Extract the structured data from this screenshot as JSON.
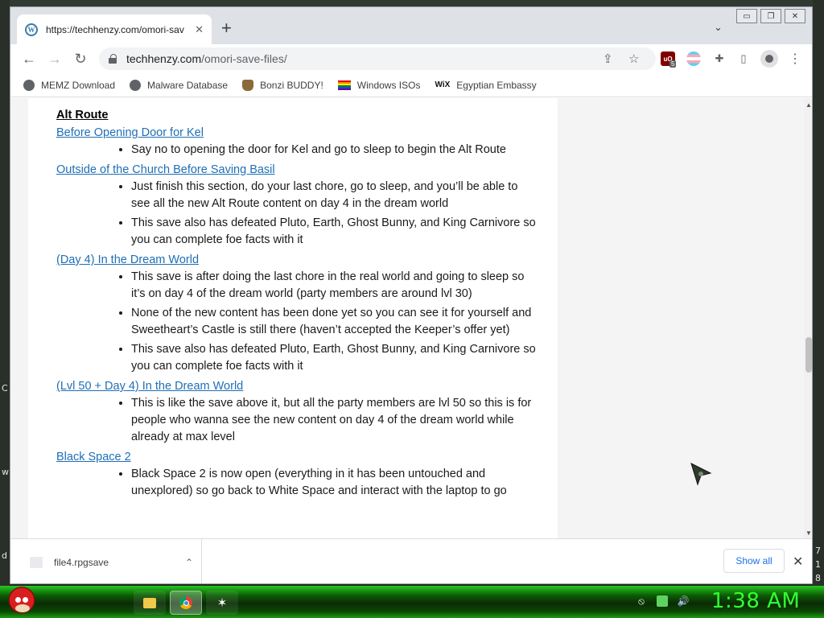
{
  "desktop": {
    "edge_left_chars": [
      "C",
      "w",
      "d"
    ],
    "edge_right_chars": [
      "7",
      "1",
      "8"
    ]
  },
  "window_controls": {
    "minimize": "▭",
    "restore": "❐",
    "close": "✕"
  },
  "tab": {
    "title": "https://techhenzy.com/omori-sav",
    "favicon": "W",
    "close": "✕"
  },
  "tabstrip": {
    "new_tab": "+",
    "tab_search": "⌄"
  },
  "toolbar": {
    "back": "←",
    "forward": "→",
    "reload": "↻",
    "url_domain": "techhenzy.com",
    "url_path": "/omori-save-files/",
    "share": "⇪",
    "bookmark_star": "☆",
    "ublock_label": "uO",
    "ublock_count": "5",
    "extensions": "✚",
    "side_panel": "▯",
    "menu": "⋮"
  },
  "bookmarks": [
    {
      "label": "MEMZ Download",
      "icon": "globe-icon"
    },
    {
      "label": "Malware Database",
      "icon": "globe-icon"
    },
    {
      "label": "Bonzi BUDDY!",
      "icon": "bonzi-icon"
    },
    {
      "label": "Windows ISOs",
      "icon": "rainbow-flag-icon"
    },
    {
      "label": "Egyptian Embassy",
      "icon": "wix-icon",
      "icon_text": "WiX"
    }
  ],
  "article": {
    "section_title": "Alt Route",
    "entries": [
      {
        "link": "Before Opening Door for Kel",
        "bullets": [
          "Say no to opening the door for Kel and go to sleep to begin the Alt Route"
        ]
      },
      {
        "link": "Outside of the Church Before Saving Basil",
        "bullets": [
          "Just finish this section, do your last chore, go to sleep, and you’ll be able to see all the new Alt Route content on day 4 in the dream world",
          "This save also has defeated Pluto, Earth, Ghost Bunny, and King Carnivore so you can complete foe facts with it"
        ]
      },
      {
        "link": "(Day 4) In the Dream World",
        "bullets": [
          "This save is after doing the last chore in the real world and going to sleep so it’s on day 4 of the dream world (party members are around lvl 30)",
          "None of the new content has been done yet so you can see it for yourself and Sweetheart’s Castle is still there (haven’t accepted the Keeper’s offer yet)",
          "This save also has defeated Pluto, Earth, Ghost Bunny, and King Carnivore so you can complete foe facts with it"
        ]
      },
      {
        "link": "(Lvl 50 + Day 4) In the Dream World",
        "bullets": [
          "This is like the save above it, but all the party members are lvl 50 so this is for people who wanna see the new content on day 4 of the dream world while already at max level"
        ]
      },
      {
        "link": "Black Space 2",
        "bullets": [
          "Black Space 2 is now open (everything in it has been untouched and unexplored) so go back to White Space and interact with the laptop to go"
        ]
      }
    ]
  },
  "scrollbar": {
    "up": "▲",
    "down": "▼",
    "position_fraction": 0.58
  },
  "download_bar": {
    "filename": "file4.rpgsave",
    "chevron": "⌃",
    "show_all": "Show all",
    "close": "✕"
  },
  "taskbar": {
    "clock": "1:38 AM",
    "spider": "✶",
    "tray": [
      "⦸",
      "",
      "🔊"
    ]
  }
}
